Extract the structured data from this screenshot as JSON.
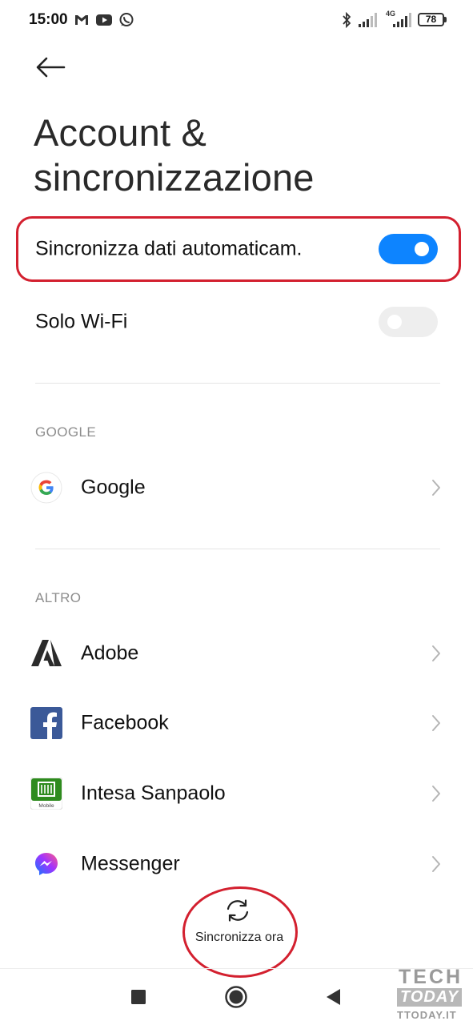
{
  "status_bar": {
    "time": "15:00",
    "network_label": "4G",
    "battery": "78",
    "notification_icons": [
      "gmail-icon",
      "youtube-icon",
      "whatsapp-icon"
    ]
  },
  "header": {
    "back_icon": "arrow-left-icon",
    "title": "Account & sincronizzazione"
  },
  "settings": {
    "auto_sync": {
      "label": "Sincronizza dati automaticam.",
      "enabled": true
    },
    "wifi_only": {
      "label": "Solo Wi-Fi",
      "enabled": false
    }
  },
  "sections": [
    {
      "header": "GOOGLE",
      "items": [
        {
          "label": "Google",
          "icon": "google-icon"
        }
      ]
    },
    {
      "header": "ALTRO",
      "items": [
        {
          "label": "Adobe",
          "icon": "adobe-icon"
        },
        {
          "label": "Facebook",
          "icon": "facebook-icon"
        },
        {
          "label": "Intesa Sanpaolo",
          "icon": "intesa-sanpaolo-icon",
          "icon_caption": "Mobile"
        },
        {
          "label": "Messenger",
          "icon": "messenger-icon"
        }
      ]
    }
  ],
  "sync_now": {
    "label": "Sincronizza ora",
    "icon": "sync-icon"
  },
  "nav_bar": {
    "icons": [
      "recents-square-icon",
      "home-circle-icon",
      "back-triangle-icon"
    ]
  },
  "watermark": {
    "line1": "TECH",
    "line2": "TODAY",
    "line3": "TTODAY.IT"
  },
  "colors": {
    "accent": "#0d84ff",
    "highlight": "#d3202f",
    "section_header": "#8d8d8d",
    "facebook": "#3b5998",
    "intesa_green": "#2e8b1e"
  }
}
